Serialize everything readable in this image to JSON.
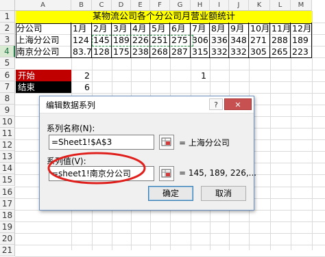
{
  "columns": [
    "A",
    "B",
    "C",
    "D",
    "E",
    "F",
    "G",
    "H",
    "I",
    "J",
    "K",
    "L",
    "M"
  ],
  "rows": [
    "1",
    "2",
    "3",
    "4",
    "5",
    "6",
    "7",
    "8",
    "9",
    "10",
    "11",
    "12",
    "13",
    "14",
    "15",
    "16",
    "17",
    "18",
    "19",
    "20",
    "21"
  ],
  "title": "某物流公司各个分公司月营业额统计",
  "header": [
    "分公司",
    "1月",
    "2月",
    "3月",
    "4月",
    "5月",
    "6月",
    "7月",
    "8月",
    "9月",
    "10月",
    "11月",
    "12月"
  ],
  "row_shanghai": [
    "上海分公司",
    "124",
    "145",
    "189",
    "226",
    "251",
    "275",
    "306",
    "336",
    "348",
    "271",
    "288",
    "189"
  ],
  "row_nanjing": [
    "南京分公司",
    "83.7",
    "128",
    "175",
    "238",
    "268",
    "287",
    "315",
    "332",
    "332",
    "305",
    "265",
    "223"
  ],
  "start_label": "开始",
  "start_value": "2",
  "start_extra": "1",
  "end_label": "结束",
  "end_value": "6",
  "colors": {
    "title_fill": "#ffff00",
    "start_fill": "#c00000",
    "end_fill": "#000000",
    "annotation": "#e0201c"
  },
  "dialog": {
    "title": "编辑数据系列",
    "help": "?",
    "close": "✕",
    "name_label": "系列名称(N):",
    "name_value": "=Sheet1!$A$3",
    "name_preview": "= 上海分公司",
    "values_label": "系列值(V):",
    "values_value": "=sheet1!南京分公司",
    "values_preview": "= 145, 189, 226,...",
    "ok": "确定",
    "cancel": "取消"
  }
}
